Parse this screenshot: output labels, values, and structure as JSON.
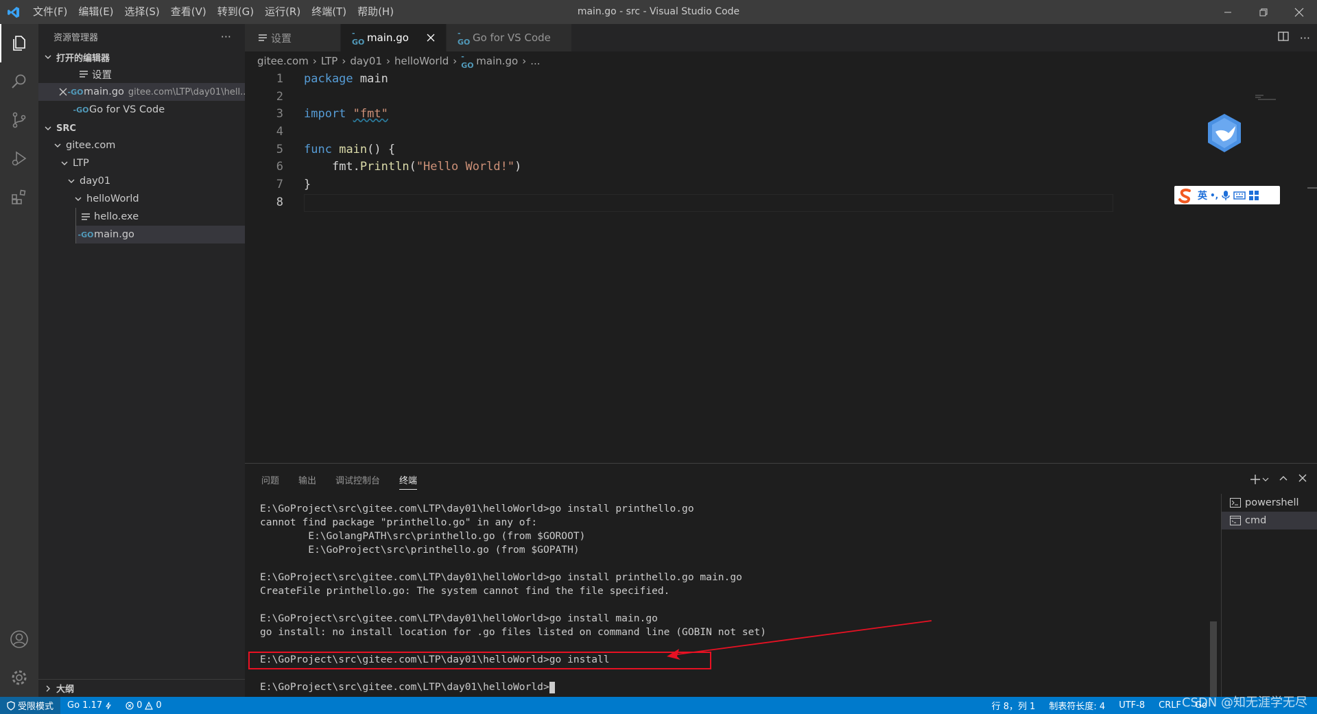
{
  "window": {
    "title": "main.go - src - Visual Studio Code",
    "menu": [
      "文件(F)",
      "编辑(E)",
      "选择(S)",
      "查看(V)",
      "转到(G)",
      "运行(R)",
      "终端(T)",
      "帮助(H)"
    ]
  },
  "sidebar": {
    "title": "资源管理器",
    "more": "···",
    "open_editors": {
      "header": "打开的编辑器",
      "items": [
        {
          "label": "设置",
          "desc": ""
        },
        {
          "label": "main.go",
          "desc": "gitee.com\\LTP\\day01\\hell..."
        },
        {
          "label": "Go for VS Code",
          "desc": ""
        }
      ]
    },
    "folder": {
      "header": "SRC",
      "tree": [
        "gitee.com",
        "LTP",
        "day01",
        "helloWorld",
        "hello.exe",
        "main.go"
      ]
    },
    "outline": "大纲"
  },
  "tabs": [
    {
      "label": "设置"
    },
    {
      "label": "main.go"
    },
    {
      "label": "Go for VS Code"
    }
  ],
  "breadcrumb": [
    "gitee.com",
    "LTP",
    "day01",
    "helloWorld",
    "main.go",
    "..."
  ],
  "code": {
    "line_numbers": [
      "1",
      "2",
      "3",
      "4",
      "5",
      "6",
      "7",
      "8"
    ],
    "l1": {
      "kw": "package",
      "rest": " main"
    },
    "l3": {
      "kw": "import",
      "sp": " ",
      "str": "\"fmt\""
    },
    "l5": {
      "kw": "func",
      "sp": " ",
      "fn": "main",
      "rest": "() {"
    },
    "l6": {
      "indent": "    ",
      "pkg": "fmt.",
      "fn": "Println",
      "open": "(",
      "str": "\"Hello World!\"",
      "close": ")"
    },
    "l7": {
      "rest": "}"
    }
  },
  "ime": {
    "label": "英",
    "punct": "•,"
  },
  "panel": {
    "tabs": [
      "问题",
      "输出",
      "调试控制台",
      "终端"
    ],
    "terminal_lines": [
      "E:\\GoProject\\src\\gitee.com\\LTP\\day01\\helloWorld>go install printhello.go",
      "cannot find package \"printhello.go\" in any of:",
      "        E:\\GolangPATH\\src\\printhello.go (from $GOROOT)",
      "        E:\\GoProject\\src\\printhello.go (from $GOPATH)",
      "",
      "E:\\GoProject\\src\\gitee.com\\LTP\\day01\\helloWorld>go install printhello.go main.go",
      "CreateFile printhello.go: The system cannot find the file specified.",
      "",
      "E:\\GoProject\\src\\gitee.com\\LTP\\day01\\helloWorld>go install main.go",
      "go install: no install location for .go files listed on command line (GOBIN not set)",
      "",
      "E:\\GoProject\\src\\gitee.com\\LTP\\day01\\helloWorld>go install",
      "",
      "E:\\GoProject\\src\\gitee.com\\LTP\\day01\\helloWorld>"
    ],
    "terminals": [
      "powershell",
      "cmd"
    ]
  },
  "status": {
    "restricted": "受限模式",
    "go_version": "Go 1.17",
    "errors": "0",
    "warnings": "0",
    "position": "行 8，列 1",
    "tab_size": "制表符长度: 4",
    "encoding": "UTF-8",
    "eol": "CRLF",
    "language": "Go"
  },
  "watermark": "CSDN @知无涯学无尽",
  "colors": {
    "accent": "#007acc",
    "highlight": "#e81123"
  }
}
